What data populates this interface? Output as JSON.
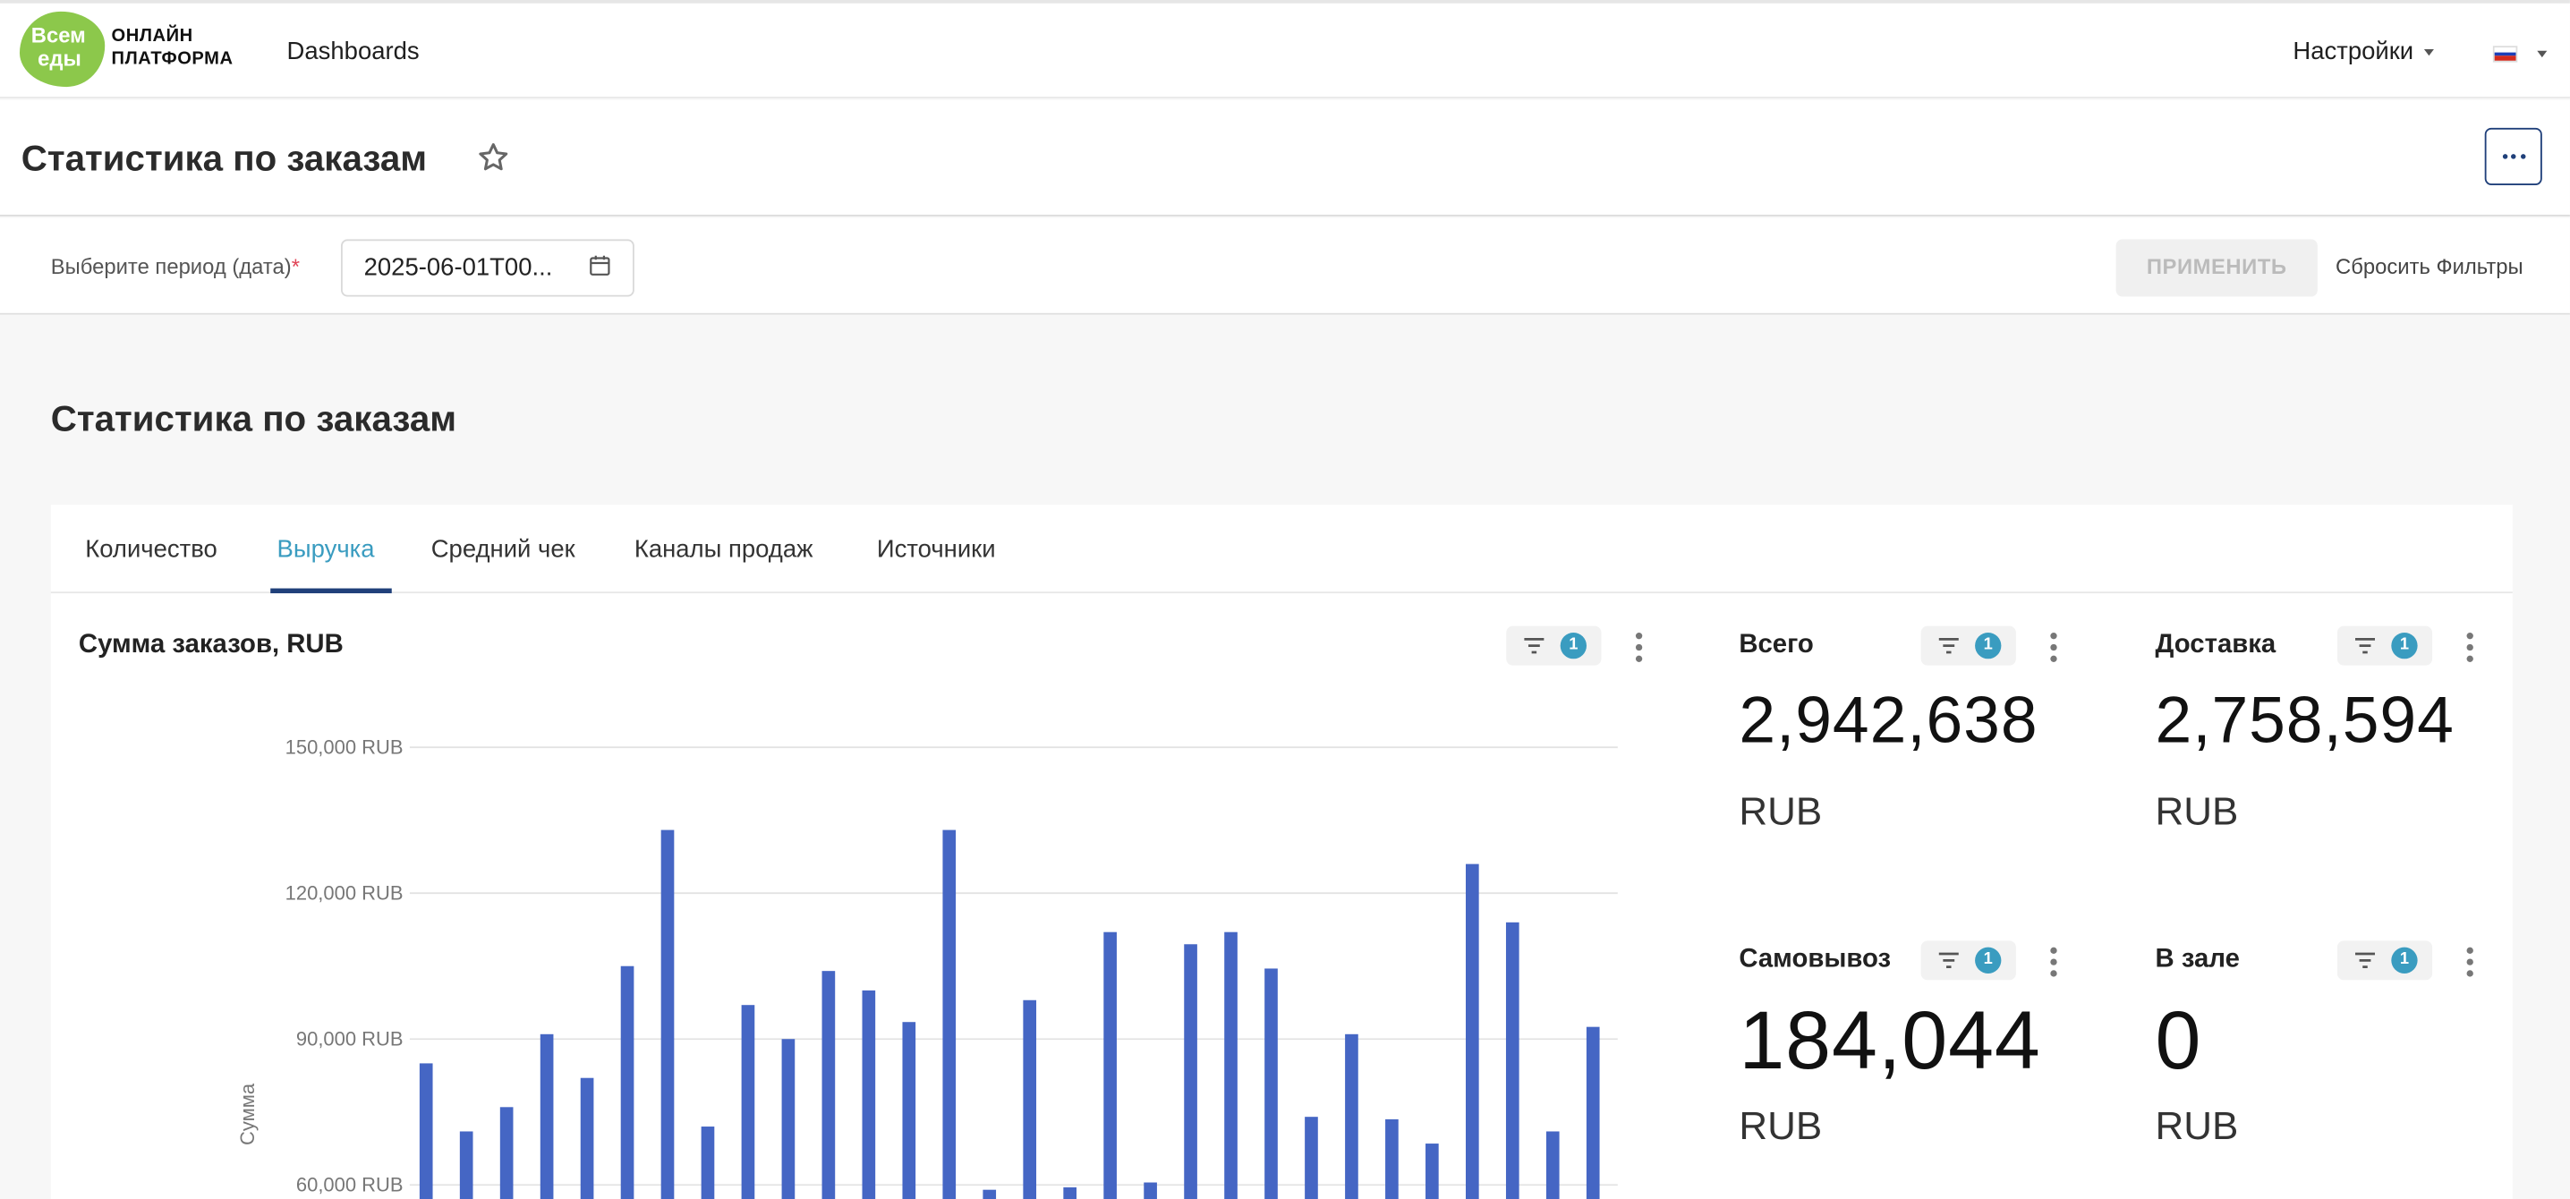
{
  "header": {
    "logo_mark_line1": "Всем",
    "logo_mark_line2": "еды",
    "logo_text_line1": "ОНЛАЙН",
    "logo_text_line2": "ПЛАТФОРМА",
    "nav_dashboards": "Dashboards",
    "nav_settings": "Настройки",
    "flag_colors": [
      "#ffffff",
      "#1c3fb8",
      "#d52b1e"
    ]
  },
  "page": {
    "title": "Статистика по заказам",
    "star_icon": "star-outline-icon",
    "more_icon": "more-horizontal-icon"
  },
  "filters": {
    "period_label": "Выберите период (дата)",
    "required_mark": "*",
    "date_value": "2025-06-01T00...",
    "apply_label": "ПРИМЕНИТЬ",
    "reset_label": "Сбросить Фильтры"
  },
  "section": {
    "title": "Статистика по заказам"
  },
  "tabs": [
    {
      "label": "Количество",
      "active": false
    },
    {
      "label": "Выручка",
      "active": true
    },
    {
      "label": "Средний чек",
      "active": false
    },
    {
      "label": "Каналы продаж",
      "active": false
    },
    {
      "label": "Источники",
      "active": false
    }
  ],
  "chart_panel": {
    "title": "Сумма заказов, RUB",
    "filter_count": "1"
  },
  "kpis": [
    {
      "title": "Всего",
      "value": "2,942,638",
      "unit": "RUB",
      "filter_count": "1"
    },
    {
      "title": "Доставка",
      "value": "2,758,594",
      "unit": "RUB",
      "filter_count": "1"
    },
    {
      "title": "Самовывоз",
      "value": "184,044",
      "unit": "RUB",
      "filter_count": "1"
    },
    {
      "title": "В зале",
      "value": "0",
      "unit": "RUB",
      "filter_count": "1"
    }
  ],
  "colors": {
    "accent": "#3a9cc0",
    "primary_dark": "#20407a",
    "bar": "#4566c4",
    "logo_green": "#8cc84b"
  },
  "chart_data": {
    "type": "bar",
    "ylabel": "Сумма",
    "ylim": [
      50000,
      150000
    ],
    "y_ticks": [
      60000,
      90000,
      120000,
      150000
    ],
    "y_tick_labels": [
      "60,000 RUB",
      "90,000 RUB",
      "120,000 RUB",
      "150,000 RUB"
    ],
    "grid": true,
    "series": [
      {
        "values": [
          85000,
          71000,
          76000,
          91000,
          82000,
          105000,
          133000,
          72000,
          97000,
          90000,
          104000,
          100000,
          93500,
          133000,
          59000,
          98000,
          59500,
          112000,
          60500,
          109500,
          112000,
          104500,
          74000,
          91000,
          73500,
          68500,
          126000,
          114000,
          71000,
          92500
        ]
      }
    ]
  }
}
